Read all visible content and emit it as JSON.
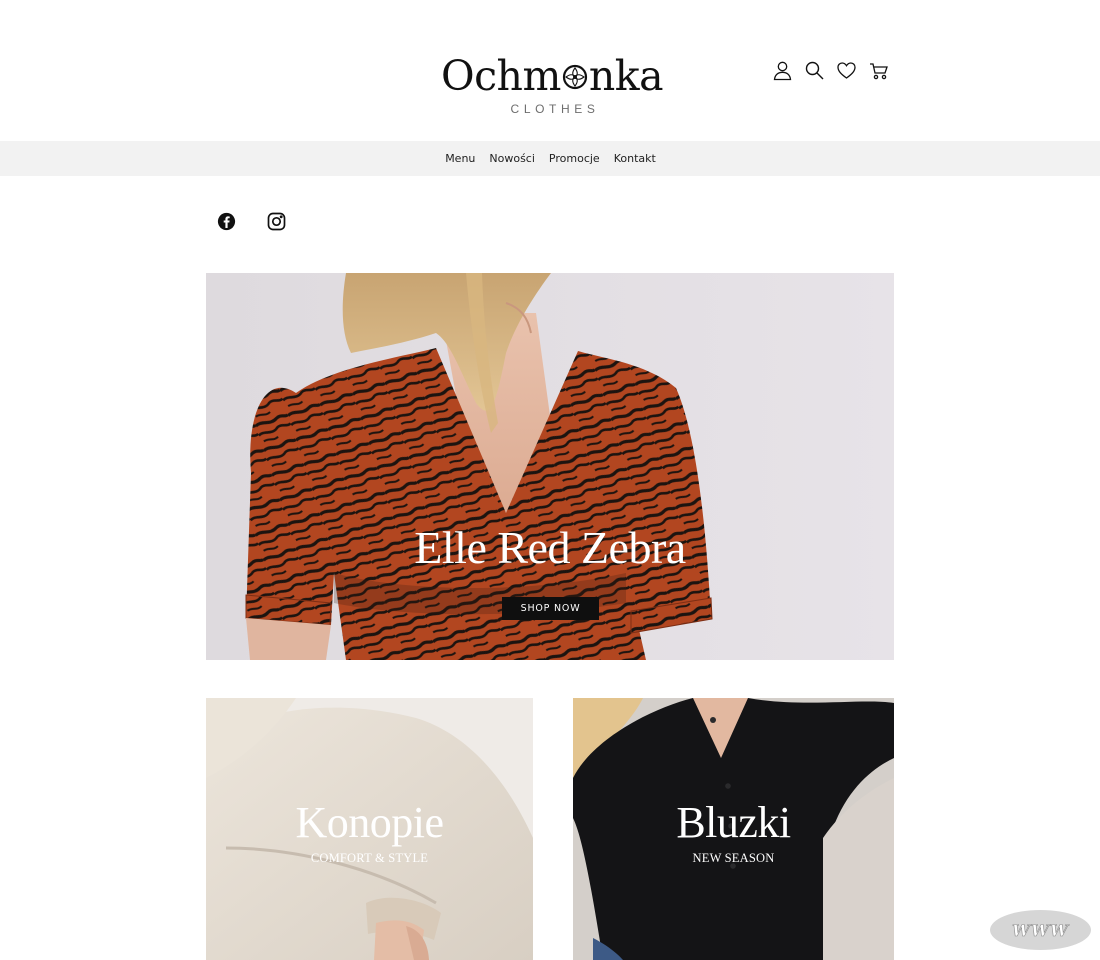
{
  "brand": {
    "logo_left": "Ochm",
    "logo_right": "nka",
    "logo_sub": "CLOTHES"
  },
  "header_icons": [
    "user-icon",
    "search-icon",
    "heart-icon",
    "cart-icon"
  ],
  "nav": {
    "items": [
      {
        "label": "Menu"
      },
      {
        "label": "Nowości"
      },
      {
        "label": "Promocje"
      },
      {
        "label": "Kontakt"
      }
    ]
  },
  "social": [
    "facebook-icon",
    "instagram-icon"
  ],
  "hero": {
    "title": "Elle Red Zebra",
    "button_label": "SHOP NOW"
  },
  "categories": [
    {
      "title": "Konopie",
      "subtitle": "COMFORT & STYLE"
    },
    {
      "title": "Bluzki",
      "subtitle": "NEW SEASON"
    }
  ],
  "badge": {
    "label": "WWW"
  },
  "colors": {
    "nav_bg": "#f2f2f2",
    "hero_bg": "#e3dee4",
    "dress_red": "#b0431f",
    "button_bg": "#0f0f0f"
  }
}
